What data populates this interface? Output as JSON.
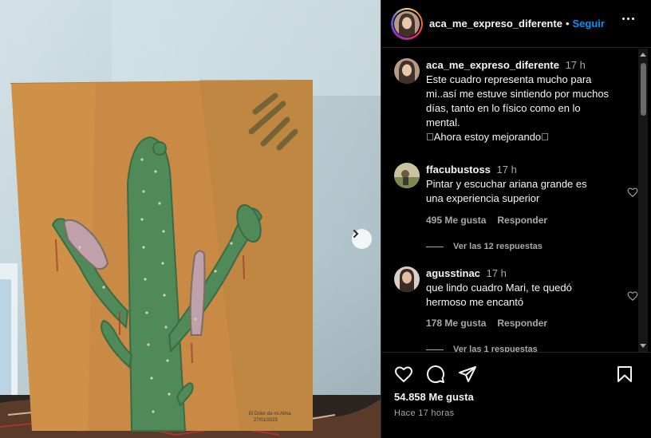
{
  "post": {
    "author": "aca_me_expreso_diferente",
    "follow_label": "Seguir",
    "separator": "•",
    "caption": {
      "time": "17 h",
      "lines": [
        "Este cuadro representa mucho para",
        "mi..así me estuve sintiendo por muchos",
        "días, tanto en lo físico como en lo",
        "mental.",
        "\u0000Ahora estoy mejorando\u0000"
      ]
    },
    "likes": "54.858 Me gusta",
    "posted_ago": "Hace 17 horas"
  },
  "painting_signature": [
    "El Dolor de mi Alma",
    "27/01/2025"
  ],
  "comments": [
    {
      "user": "ffacubustoss",
      "time": "17 h",
      "lines": [
        "Pintar y escuchar ariana grande es",
        "una experiencia superior"
      ],
      "likes": "495 Me gusta",
      "reply_label": "Responder",
      "view_replies": "Ver las 12 respuestas"
    },
    {
      "user": "agusstinac",
      "time": "17 h",
      "lines": [
        "que lindo cuadro Mari, te quedó",
        "hermoso me encantó"
      ],
      "likes": "178 Me gusta",
      "reply_label": "Responder",
      "view_replies": "Ver las 1 respuestas"
    }
  ],
  "icons": {
    "like": "heart-icon",
    "comment": "comment-icon",
    "share": "send-icon",
    "save": "bookmark-icon",
    "more": "more-options-icon",
    "next": "chevron-right-icon"
  },
  "colors": {
    "background": "#000000",
    "link_blue": "#0095f6",
    "muted": "#a8a8a8",
    "painting_orange": "#c98a45",
    "cactus_green": "#4f8a58"
  }
}
